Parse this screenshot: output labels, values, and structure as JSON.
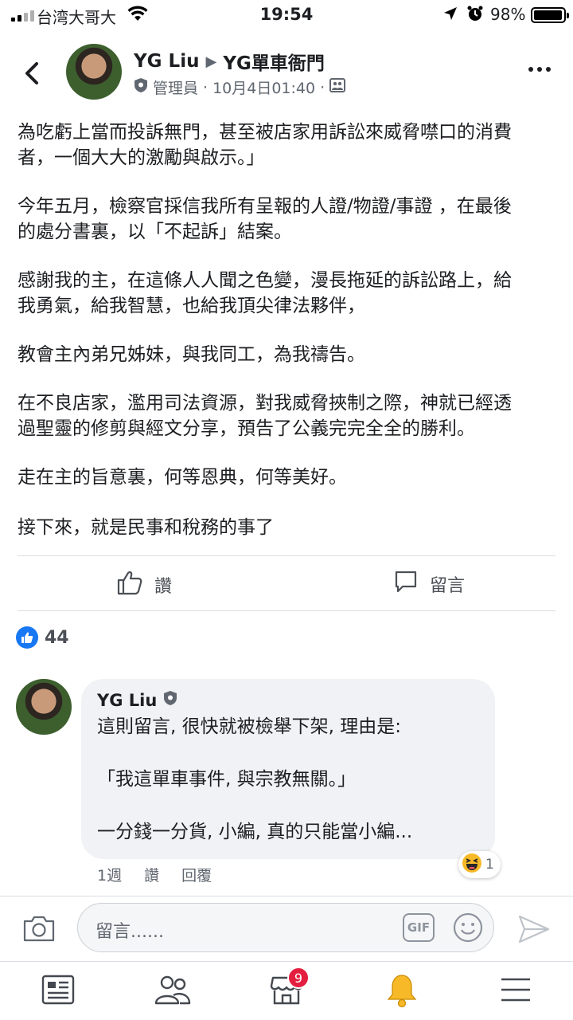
{
  "status_bar": {
    "carrier": "台湾大哥大",
    "time": "19:54",
    "battery_percent": "98%",
    "battery_level": 0.98
  },
  "post": {
    "author": "YG Liu",
    "group": "YG單車衙門",
    "role": "管理員",
    "separator": "·",
    "date": "10月4日01:40",
    "paragraphs": [
      "為吃虧上當而投訴無門，甚至被店家用訴訟來威脅噤口的消費\n者，一個大大的激勵與啟示。」",
      "今年五月，檢察官採信我所有呈報的人證/物證/事證 ，在最後\n的處分書裏，以「不起訴」結案。",
      "感謝我的主，在這條人人聞之色變，漫長拖延的訴訟路上，給\n我勇氣，給我智慧，也給我頂尖律法夥伴，",
      "教會主內弟兄姊妹，與我同工，為我禱告。",
      "在不良店家，濫用司法資源，對我威脅挾制之際，神就已經透\n過聖靈的修剪與經文分享，預告了公義完完全全的勝利。",
      "走在主的旨意裏，何等恩典，何等美好。",
      "接下來，就是民事和稅務的事了"
    ],
    "like_label": "讚",
    "comment_label": "留言",
    "like_count": "44"
  },
  "comment": {
    "author": "YG Liu",
    "text": "這則留言, 很快就被檢舉下架, 理由是:\n\n「我這單車事件, 與宗教無關。」\n\n一分錢一分貨, 小編, 真的只能當小編...",
    "reaction_count": "1",
    "time": "1週",
    "like_label": "讚",
    "reply_label": "回覆"
  },
  "composer": {
    "placeholder": "留言......",
    "gif_label": "GIF"
  },
  "bottom_nav": {
    "marketplace_badge": "9"
  },
  "colors": {
    "accent": "#1877f2",
    "badge": "#e41e3f",
    "notification_bell": "#f7b928"
  }
}
